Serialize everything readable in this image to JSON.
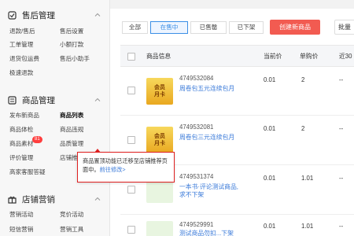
{
  "sidebar": {
    "sections": [
      {
        "title": "售后管理",
        "items": [
          [
            "退款/售后",
            "售后设置"
          ],
          [
            "工单管理",
            "小额打款"
          ],
          [
            "退货包运费",
            "售后小助手"
          ],
          [
            "极速退款",
            ""
          ]
        ]
      },
      {
        "title": "商品管理",
        "items": [
          [
            "发布新商品",
            "商品列表"
          ],
          [
            "商品体检",
            "商品违规"
          ],
          [
            "商品素材",
            "品质管理"
          ],
          [
            "评价管理",
            "店铺推荐"
          ],
          [
            "高家客服答疑",
            ""
          ]
        ],
        "badge": "81",
        "active_item": "商品列表"
      },
      {
        "title": "店铺营销",
        "items": [
          [
            "营销活动",
            "竞价活动"
          ],
          [
            "短信营销",
            "营销工具"
          ]
        ]
      }
    ]
  },
  "tabs": [
    {
      "label": "全部",
      "active": false
    },
    {
      "label": "在售中",
      "active": true
    },
    {
      "label": "已售罄",
      "active": false
    },
    {
      "label": "已下架",
      "active": false
    }
  ],
  "buttons": {
    "create": "创建新商品",
    "batch": "批量"
  },
  "table": {
    "headers": [
      "商品信息",
      "当前价",
      "单购价",
      "近30"
    ],
    "rows": [
      {
        "id": "4749532084",
        "name": "周卷包五元连续包月",
        "price": "0.01",
        "single": "2",
        "recent": "--",
        "thumb": "gold",
        "thumb_lines": [
          "会员",
          "月卡"
        ]
      },
      {
        "id": "4749532081",
        "name": "周卷包三元连续包月",
        "price": "0.01",
        "single": "2",
        "recent": "--",
        "thumb": "gold",
        "thumb_lines": [
          "会员",
          "月卡"
        ]
      },
      {
        "id": "4749531374",
        "name": "一本书·评论测试商品,求不下架",
        "price": "0.01",
        "single": "1.01",
        "recent": "--",
        "thumb": "green",
        "thumb_lines": [
          "",
          ""
        ]
      },
      {
        "id": "4749529991",
        "name": "测试商品勿扣...下架",
        "price": "0.01",
        "single": "1.01",
        "recent": "--",
        "thumb": "green",
        "thumb_lines": [
          "",
          ""
        ]
      }
    ]
  },
  "tooltip": {
    "text": "商品置顶功能已迁移至店铺推荐页面中。",
    "link": "前往修改>"
  },
  "colors": {
    "accent": "#3a8ee6",
    "danger": "#f25b51",
    "tooltip_border": "#e02020"
  }
}
